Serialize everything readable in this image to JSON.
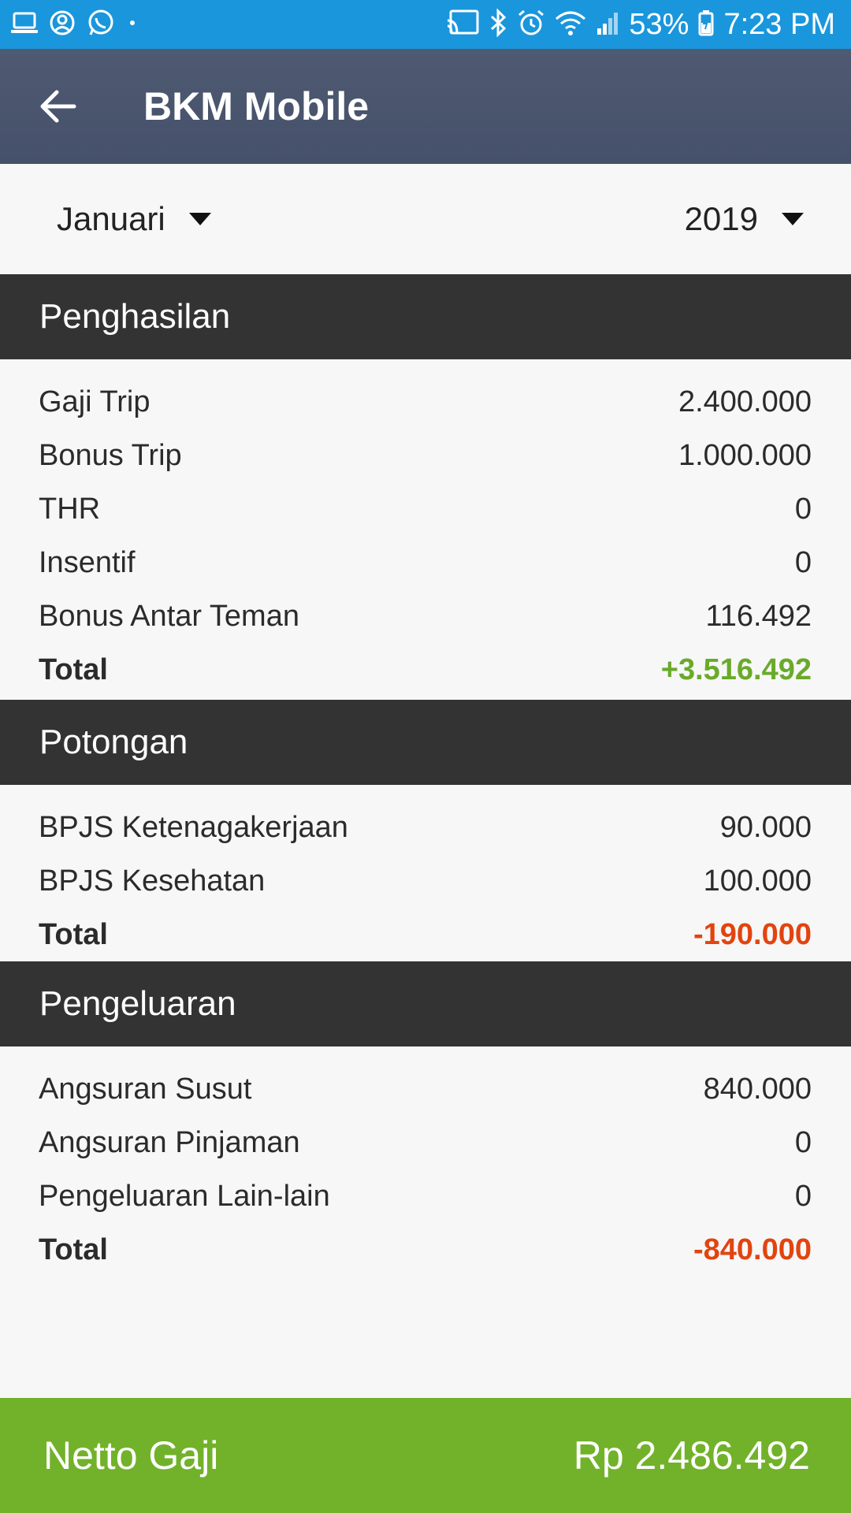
{
  "status_bar": {
    "battery": "53%",
    "time": "7:23 PM"
  },
  "app": {
    "title": "BKM Mobile"
  },
  "filters": {
    "month": "Januari",
    "year": "2019"
  },
  "sections": {
    "penghasilan": {
      "title": "Penghasilan",
      "rows": [
        {
          "label": "Gaji Trip",
          "value": "2.400.000"
        },
        {
          "label": "Bonus Trip",
          "value": "1.000.000"
        },
        {
          "label": "THR",
          "value": "0"
        },
        {
          "label": "Insentif",
          "value": "0"
        },
        {
          "label": "Bonus Antar Teman",
          "value": "116.492"
        }
      ],
      "total_label": "Total",
      "total_value": "+3.516.492"
    },
    "potongan": {
      "title": "Potongan",
      "rows": [
        {
          "label": "BPJS Ketenagakerjaan",
          "value": "90.000"
        },
        {
          "label": "BPJS Kesehatan",
          "value": "100.000"
        }
      ],
      "total_label": "Total",
      "total_value": "-190.000"
    },
    "pengeluaran": {
      "title": "Pengeluaran",
      "rows": [
        {
          "label": "Angsuran Susut",
          "value": "840.000"
        },
        {
          "label": "Angsuran Pinjaman",
          "value": "0"
        },
        {
          "label": "Pengeluaran Lain-lain",
          "value": "0"
        }
      ],
      "total_label": "Total",
      "total_value": "-840.000"
    }
  },
  "netto": {
    "label": "Netto Gaji",
    "amount": "Rp 2.486.492"
  },
  "colors": {
    "status_bar": "#1a96dc",
    "app_bar": "#4b566e",
    "section_header": "#333333",
    "positive": "#6aaa2a",
    "negative": "#e2440f",
    "netto_bar": "#72b22a"
  },
  "icons": {
    "status_left": [
      "laptop-icon",
      "account-circle-icon",
      "whatsapp-icon",
      "dot-icon"
    ],
    "status_right": [
      "cast-icon",
      "bluetooth-icon",
      "alarm-icon",
      "wifi-icon",
      "signal-icon",
      "battery-charging-icon"
    ],
    "back": "arrow-back-icon",
    "dropdown": "caret-down-icon"
  }
}
